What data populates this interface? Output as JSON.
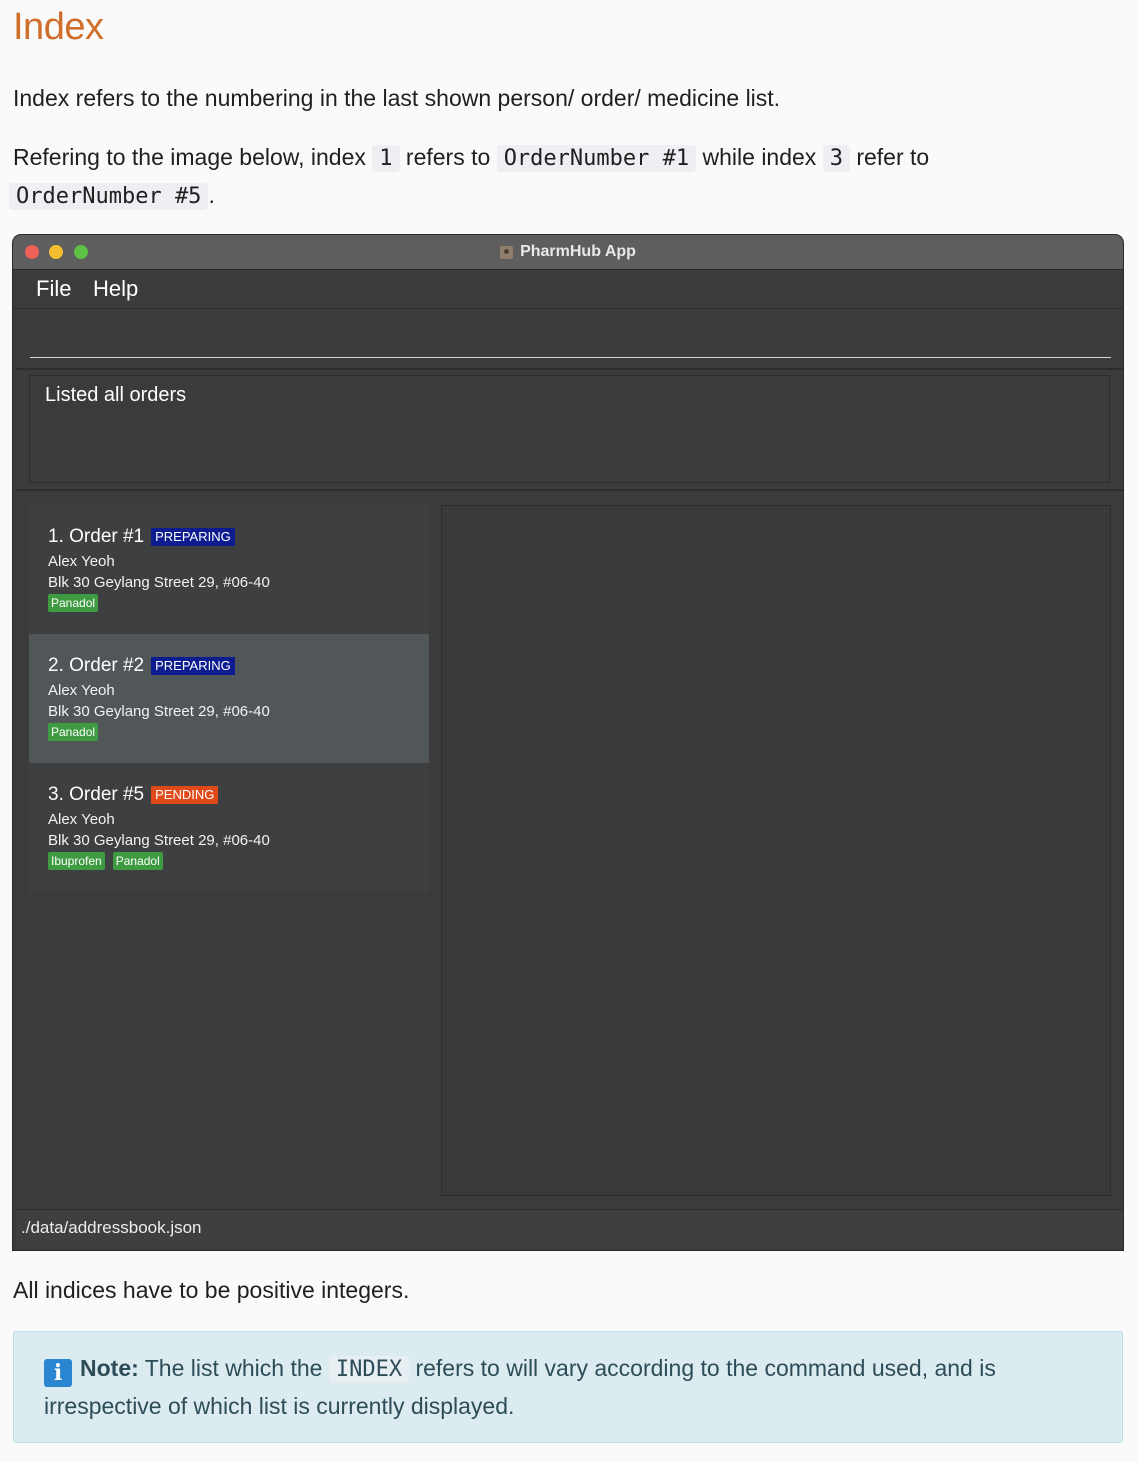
{
  "heading": "Index",
  "intro": "Index refers to the numbering in the last shown person/ order/ medicine list.",
  "example": {
    "part1": "Refering to the image below, index ",
    "code1": "1",
    "part2": " refers to ",
    "code2": "OrderNumber #1",
    "part3": " while index ",
    "code3": "3",
    "part4": " refer to ",
    "code4": "OrderNumber #5",
    "part5": "."
  },
  "app": {
    "title": "PharmHub App",
    "menu": [
      "File",
      "Help"
    ],
    "command_value": "",
    "result_message": "Listed all orders",
    "orders": [
      {
        "index": "1.",
        "title": "Order #1",
        "status": "PREPARING",
        "status_type": "preparing",
        "name": "Alex Yeoh",
        "address": "Blk 30 Geylang Street 29, #06-40",
        "medicines": [
          "Panadol"
        ],
        "selected": false
      },
      {
        "index": "2.",
        "title": "Order #2",
        "status": "PREPARING",
        "status_type": "preparing",
        "name": "Alex Yeoh",
        "address": "Blk 30 Geylang Street 29, #06-40",
        "medicines": [
          "Panadol"
        ],
        "selected": true
      },
      {
        "index": "3.",
        "title": "Order #5",
        "status": "PENDING",
        "status_type": "pending",
        "name": "Alex Yeoh",
        "address": "Blk 30 Geylang Street 29, #06-40",
        "medicines": [
          "Ibuprofen",
          "Panadol"
        ],
        "selected": false
      }
    ],
    "status_path": "./data/addressbook.json",
    "colors": {
      "preparing": "#0d1c8f",
      "pending": "#e04a1a",
      "tag": "#3f9b42",
      "window": "#3b3b3b"
    }
  },
  "positive_note": "All indices have to be positive integers.",
  "note": {
    "icon": "info-icon",
    "label": "Note:",
    "part1": " The list which the ",
    "code": "INDEX",
    "part2": " refers to will vary according to the command used, and is irrespective of which list is currently displayed."
  }
}
